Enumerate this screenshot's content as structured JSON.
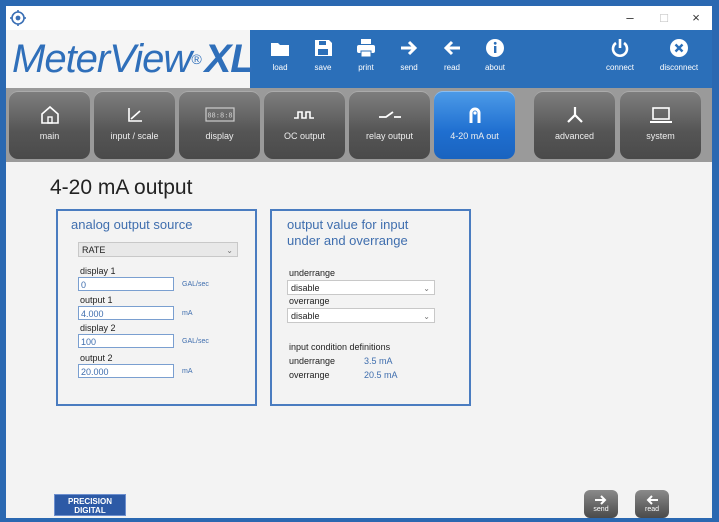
{
  "window": {
    "controls": {
      "minimize": "–",
      "maximize": "□",
      "close": "×"
    }
  },
  "brand": {
    "name": "MeterView",
    "reg": "®",
    "suffix": "XL"
  },
  "toolbar": {
    "items": [
      {
        "label": "load",
        "icon": "folder-icon"
      },
      {
        "label": "save",
        "icon": "floppy-icon"
      },
      {
        "label": "print",
        "icon": "printer-icon"
      },
      {
        "label": "send",
        "icon": "arrow-right-icon"
      },
      {
        "label": "read",
        "icon": "arrow-left-icon"
      },
      {
        "label": "about",
        "icon": "info-icon"
      },
      {
        "label": "connect",
        "icon": "power-icon"
      },
      {
        "label": "disconnect",
        "icon": "x-circle-icon"
      }
    ]
  },
  "nav": {
    "tabs": [
      {
        "label": "main",
        "icon": "house-icon"
      },
      {
        "label": "input / scale",
        "icon": "graph-icon"
      },
      {
        "label": "display",
        "icon": "display-icon",
        "display_text": "88:8:8"
      },
      {
        "label": "OC output",
        "icon": "pulse-icon"
      },
      {
        "label": "relay output",
        "icon": "relay-icon"
      },
      {
        "label": "4-20 mA out",
        "icon": "loop-icon",
        "active": true
      },
      {
        "label": "advanced",
        "icon": "wrench-icon"
      },
      {
        "label": "system",
        "icon": "laptop-icon"
      }
    ]
  },
  "page": {
    "title": "4-20 mA output"
  },
  "analog": {
    "title": "analog output source",
    "source": "RATE",
    "display1": {
      "label": "display 1",
      "value": "0",
      "unit": "GAL/sec"
    },
    "output1": {
      "label": "output 1",
      "value": "4.000",
      "unit": "mA"
    },
    "display2": {
      "label": "display 2",
      "value": "100",
      "unit": "GAL/sec"
    },
    "output2": {
      "label": "output 2",
      "value": "20.000",
      "unit": "mA"
    }
  },
  "range": {
    "title_line1": "output value for input",
    "title_line2": "under and overrange",
    "underrange_label": "underrange",
    "underrange_value": "disable",
    "overrange_label": "overrange",
    "overrange_value": "disable",
    "defs_title": "input condition definitions",
    "def_under_label": "underrange",
    "def_under_value": "3.5 mA",
    "def_over_label": "overrange",
    "def_over_value": "20.5 mA"
  },
  "footer": {
    "badge_line1": "PRECISION",
    "badge_line2": "DIGITAL",
    "send": "send",
    "read": "read"
  },
  "colors": {
    "accent": "#2b6fb9",
    "active_tab": "#1f6fd0",
    "text_blue": "#3f6eae"
  }
}
